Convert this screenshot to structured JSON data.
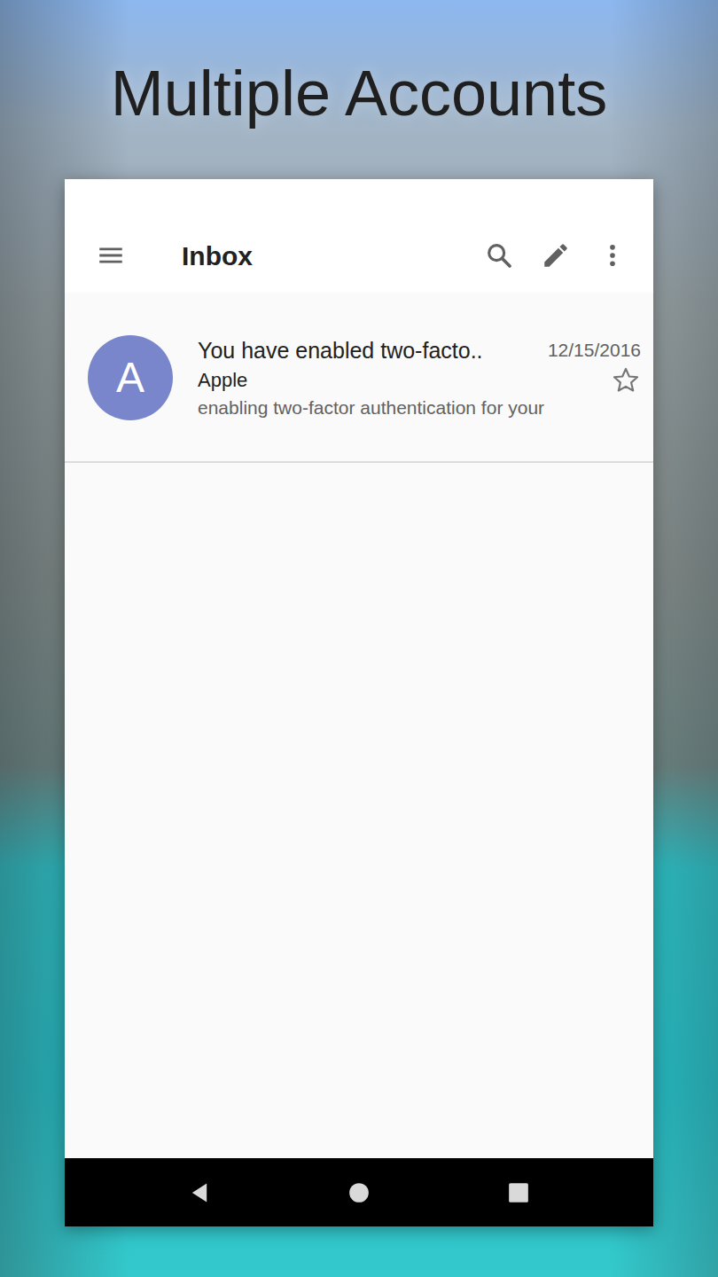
{
  "promo": {
    "title": "Multiple Accounts"
  },
  "app_bar": {
    "title": "Inbox"
  },
  "messages": [
    {
      "avatar": "A",
      "subject": "You have enabled two-facto..",
      "sender": "Apple",
      "snippet": "enabling two-factor authentication for your",
      "date": "12/15/2016",
      "starred": false
    }
  ]
}
